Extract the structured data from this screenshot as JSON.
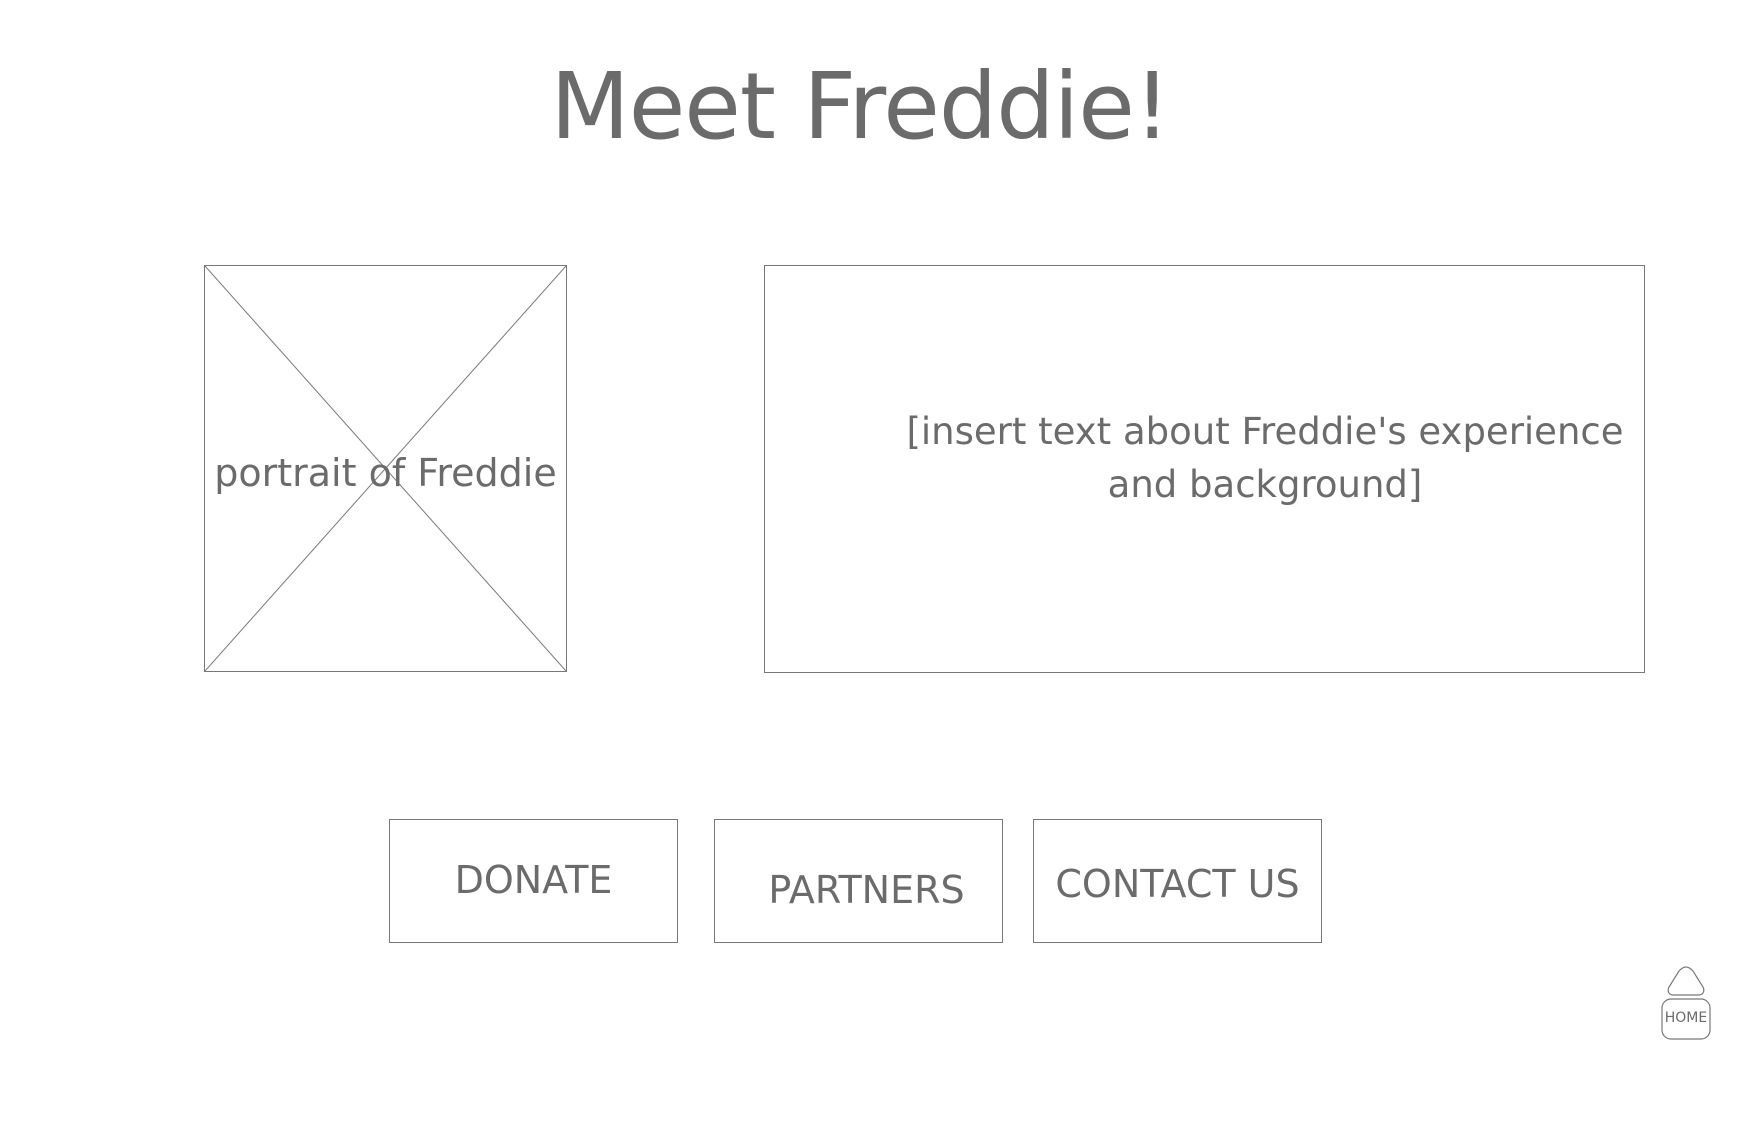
{
  "page": {
    "title": "Meet Freddie!"
  },
  "portrait": {
    "label": "portrait of Freddie",
    "icon": "image-placeholder-icon"
  },
  "bio": {
    "text_line1": "[insert text about Freddie's experience",
    "text_line2": "and background]"
  },
  "nav_buttons": [
    {
      "label": "DONATE"
    },
    {
      "label": "PARTNERS"
    },
    {
      "label": "CONTACT US"
    }
  ],
  "home": {
    "label": "HOME",
    "icon": "home-icon"
  },
  "colors": {
    "text": "#6b6b6b",
    "border": "#777777",
    "background": "#ffffff"
  }
}
